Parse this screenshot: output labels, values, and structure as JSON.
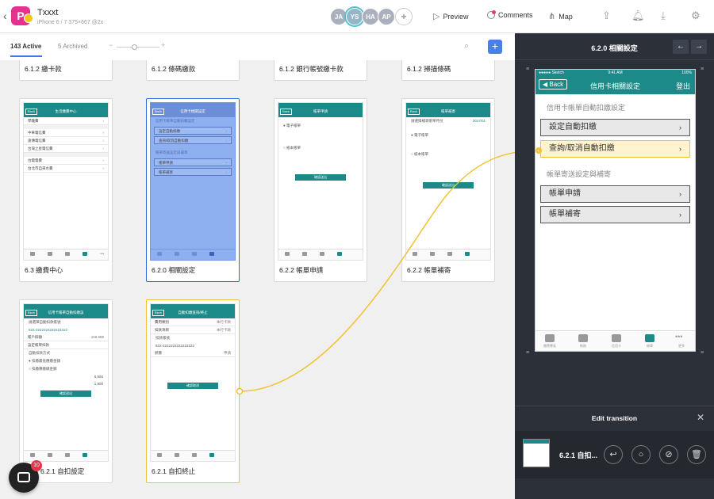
{
  "header": {
    "logo_letter": "P",
    "project_name": "Txxxt",
    "device_info": "iPhone 6 / 7   375×667 @2x",
    "avatars": [
      "JA",
      "YS",
      "HA",
      "AP"
    ],
    "add_member": "+",
    "preview_label": "Preview",
    "comments_label": "Comments",
    "map_label": "Map"
  },
  "subbar": {
    "active_tab": "143 Active",
    "archived_tab": "5 Archived",
    "zoom_minus": "−",
    "zoom_plus": "+",
    "add_button": "+"
  },
  "top_row_labels": [
    "6.1.2 繳卡款",
    "6.1.2 條碼繳款",
    "6.1.2 銀行帳號繳卡款",
    "6.1.2 掃描條碼"
  ],
  "cards": [
    {
      "label": "6.3 繳費中心",
      "head": "生活繳費中心",
      "rows": [
        "學雜費",
        "中華電信費",
        "遠傳電信費",
        "台灣之星電信費",
        "台電電費",
        "台北市自來水費"
      ]
    },
    {
      "label": "6.2.0 相關設定",
      "head": "信用卡相關設定",
      "rows": [
        "信用卡帳單自動扣繳設定",
        "設定自動扣繳",
        "查詢/取消自動扣繳",
        "帳單寄送設定與補寄",
        "帳單申請",
        "帳單補寄"
      ]
    },
    {
      "label": "6.2.2 帳單申請",
      "head": "帳單申請",
      "rows": [
        "電子帳單",
        "紙本帳單",
        "確認送出"
      ]
    },
    {
      "label": "6.2.2 帳單補寄",
      "head": "帳單補寄",
      "rows": [
        "請選擇補寄帳單月份",
        "2017/01",
        "電子帳單",
        "紙本帳單",
        "確認送出"
      ]
    },
    {
      "label": "6.2.1 自扣設定",
      "head": "信用卡帳單自動扣繳設",
      "rows": [
        "請選擇自動扣款帳號",
        "822-2222222222222222",
        "帳戶餘額",
        "168,888",
        "設定帳單扣款",
        "自動扣款方式",
        "扣繳最低應繳金額",
        "扣繳應繳總金額",
        "6,666",
        "1,800",
        "確認送出"
      ]
    },
    {
      "label": "6.2.1 自扣終止",
      "head": "自動扣繳查詢/終止",
      "rows": [
        "費用類別",
        "本行卡款",
        "扣款項目",
        "本行卡款",
        "扣款帳號",
        "822-2222222222222222",
        "狀態",
        "申請",
        "確認取消"
      ]
    }
  ],
  "panel": {
    "title": "6.2.0 相關設定",
    "prev": "←",
    "next": "→",
    "phone": {
      "carrier": "●●●●● Sketch",
      "time": "9:41 AM",
      "battery": "100%",
      "back": "Back",
      "title": "信用卡相關設定",
      "logout": "登出",
      "section1": "信用卡帳單自動扣繳設定",
      "row1": "設定自動扣繳",
      "row2": "查詢/取消自動扣繳",
      "section2": "帳單寄送設定與補寄",
      "row3": "帳單申請",
      "row4": "帳單補寄",
      "tabs": [
        "繳費專區",
        "帳務",
        "信用卡",
        "帳單",
        "更多"
      ]
    },
    "edit_title": "Edit transition",
    "close": "✕",
    "transition_name": "6.2.1 自扣..."
  },
  "chat": {
    "badge": "10"
  },
  "colors": {
    "brand": "#e5318f",
    "teal": "#1b8a88",
    "accent_blue": "#4a7fe8",
    "link_yellow": "#f1c232"
  }
}
